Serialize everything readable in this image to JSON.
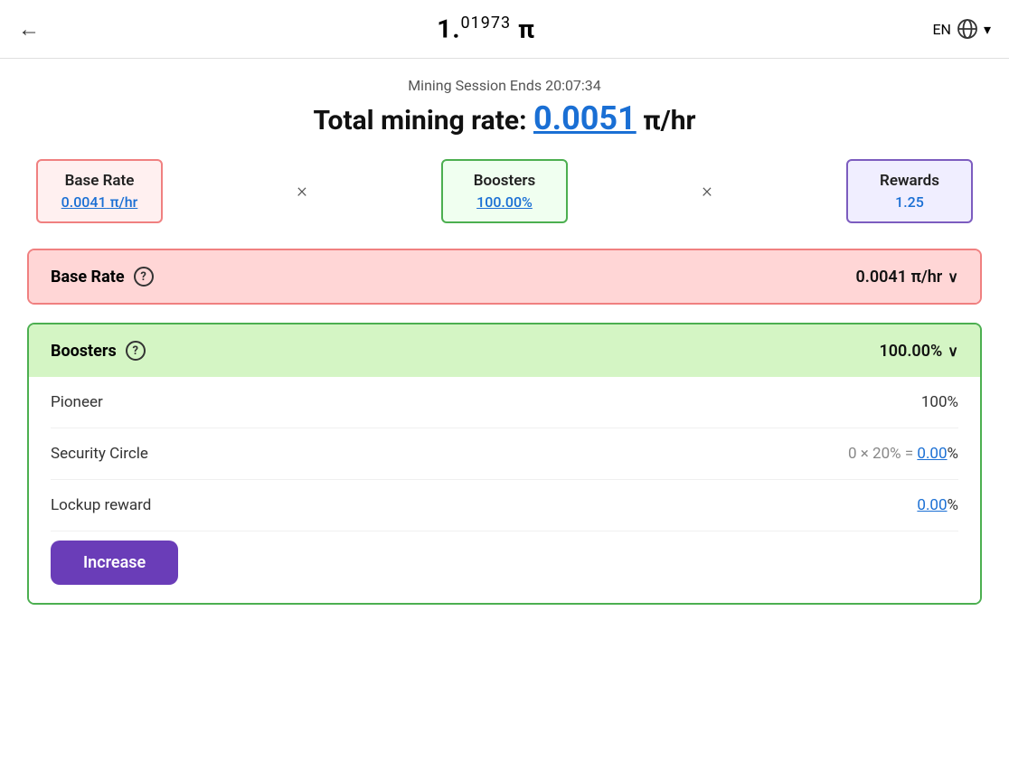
{
  "header": {
    "back_icon": "←",
    "title_prefix": "1.",
    "title_superscript": "01973",
    "title_pi": "π",
    "lang": "EN",
    "globe_icon": "globe-icon",
    "chevron_icon": "▾"
  },
  "session": {
    "session_label": "Mining Session Ends 20:07:34",
    "total_label": "Total mining rate:",
    "total_value": "0.0051",
    "total_unit": "π/hr"
  },
  "rate_cards": {
    "base": {
      "label": "Base Rate",
      "value": "0.0041",
      "unit": "π/hr"
    },
    "multiply1": "×",
    "boosters": {
      "label": "Boosters",
      "value": "100.00%"
    },
    "multiply2": "×",
    "rewards": {
      "label": "Rewards",
      "value": "1.25"
    }
  },
  "base_rate_section": {
    "label": "Base Rate",
    "help": "?",
    "value": "0.0041 π/hr",
    "chevron": "∨"
  },
  "boosters_section": {
    "label": "Boosters",
    "help": "?",
    "value": "100.00%",
    "chevron": "∨",
    "items": [
      {
        "label": "Pioneer",
        "value": "100%",
        "has_link": false
      },
      {
        "label": "Security Circle",
        "prefix": "0 × 20% = ",
        "link_value": "0.00",
        "suffix": "%",
        "has_link": true
      },
      {
        "label": "Lockup reward",
        "link_value": "0.00",
        "suffix": "%",
        "has_link": true
      }
    ],
    "increase_button": "Increase"
  }
}
